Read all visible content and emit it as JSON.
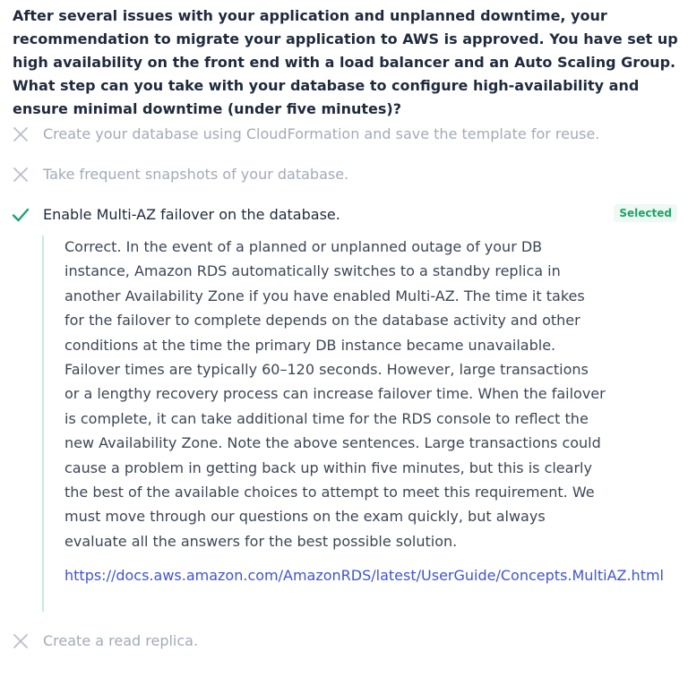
{
  "question": {
    "text": "After several issues with your application and unplanned downtime, your recommendation to migrate your application to AWS is approved. You have set up high availability on the front end with a load balancer and an Auto Scaling Group. What step can you take with your database to configure high-availability and ensure minimal downtime (under five minutes)?"
  },
  "options": [
    {
      "text": "Create your database using CloudFormation and save the template for reuse.",
      "state": "incorrect",
      "icon": "x-icon"
    },
    {
      "text": "Take frequent snapshots of your database.",
      "state": "incorrect",
      "icon": "x-icon"
    },
    {
      "text": "Enable Multi-AZ failover on the database.",
      "state": "correct",
      "icon": "check-icon",
      "badge": "Selected",
      "explanation": {
        "text": "Correct. In the event of a planned or unplanned outage of your DB instance, Amazon RDS automatically switches to a standby replica in another Availability Zone if you have enabled Multi-AZ. The time it takes for the failover to complete depends on the database activity and other conditions at the time the primary DB instance became unavailable. Failover times are typically 60–120 seconds. However, large transactions or a lengthy recovery process can increase failover time. When the failover is complete, it can take additional time for the RDS console to reflect the new Availability Zone. Note the above sentences. Large transactions could cause a problem in getting back up within five minutes, but this is clearly the best of the available choices to attempt to meet this requirement. We must move through our questions on the exam quickly, but always evaluate all the answers for the best possible solution.",
        "link": "https://docs.aws.amazon.com/AmazonRDS/latest/UserGuide/Concepts.MultiAZ.html"
      }
    },
    {
      "text": "Create a read replica.",
      "state": "incorrect",
      "icon": "x-icon"
    }
  ],
  "colors": {
    "text": "#1f2a3c",
    "faded": "#a3aab8",
    "correct": "#1aa46b",
    "link": "#3f54d6",
    "explanation_border": "#c7ecd8"
  }
}
